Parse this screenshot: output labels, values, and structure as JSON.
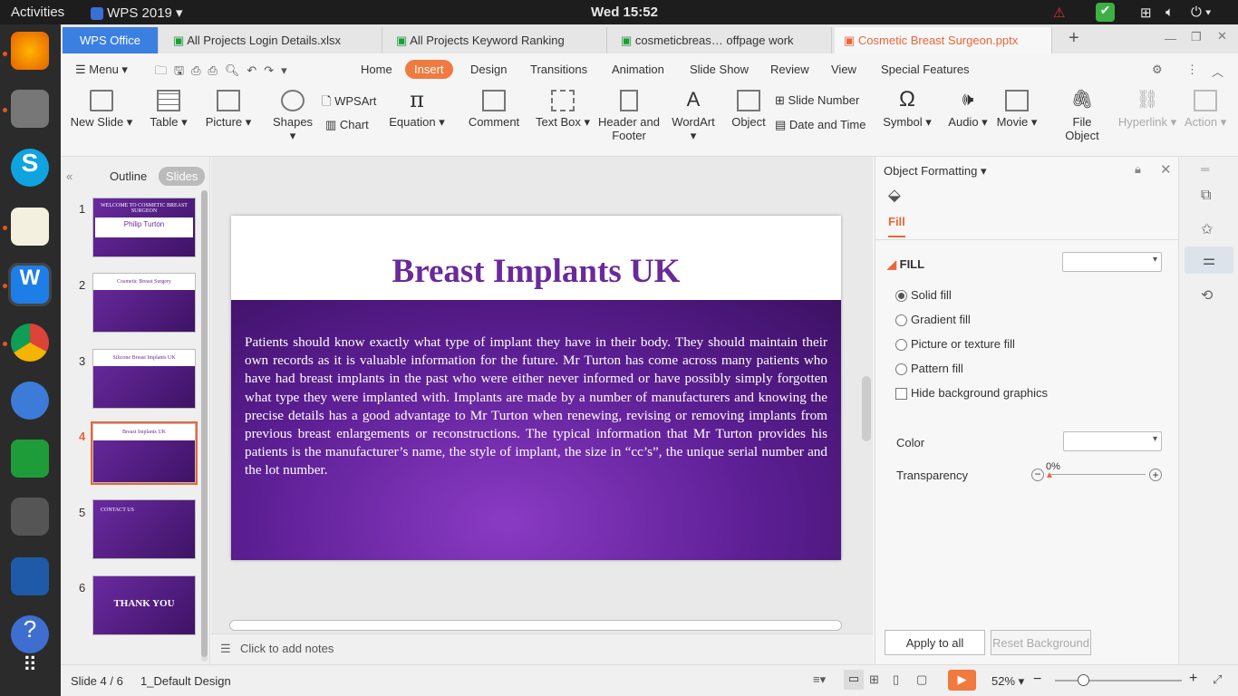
{
  "topbar": {
    "activities": "Activities",
    "app": "WPS 2019",
    "clock": "Wed 15:52"
  },
  "tabs": {
    "wps_office": "WPS Office",
    "t1": "All Projects Login Details.xlsx",
    "t2": "All Projects Keyword Ranking",
    "t3": "cosmeticbreas… offpage work",
    "t4": "Cosmetic Breast Surgeon.pptx"
  },
  "menu": {
    "menu": "Menu",
    "items": [
      "Home",
      "Insert",
      "Design",
      "Transitions",
      "Animation",
      "Slide Show",
      "Review",
      "View",
      "Special Features"
    ]
  },
  "ribbon": {
    "new_slide": "New Slide",
    "table": "Table",
    "picture": "Picture",
    "shapes": "Shapes",
    "wpsart": "WPSArt",
    "chart": "Chart",
    "equation": "Equation",
    "comment": "Comment",
    "text_box": "Text Box",
    "header_footer_1": "Header and",
    "header_footer_2": "Footer",
    "wordart": "WordArt",
    "object": "Object",
    "slide_number": "Slide Number",
    "date_time": "Date and Time",
    "symbol": "Symbol",
    "audio": "Audio",
    "movie": "Movie",
    "file_object": "File Object",
    "hyperlink": "Hyperlink",
    "action": "Action"
  },
  "leftpanel": {
    "outline": "Outline",
    "slides": "Slides",
    "thumbs": [
      {
        "num": "1",
        "title": "WELCOME TO COSMETIC BREAST SURGEON",
        "sub": "Philip Turton"
      },
      {
        "num": "2",
        "title": "Cosmetic Breast Surgery"
      },
      {
        "num": "3",
        "title": "Silicone Breast Implants UK"
      },
      {
        "num": "4",
        "title": "Breast Implants UK"
      },
      {
        "num": "5",
        "title": "CONTACT US"
      },
      {
        "num": "6",
        "title": "THANK YOU"
      }
    ]
  },
  "slide": {
    "title": "Breast Implants UK",
    "body": "Patients should know exactly what type of implant they have in their body. They should maintain their own records as it is valuable information for the future. Mr Turton has come across many patients who have had breast implants in the past who were either never informed or have possibly simply forgotten what type they were implanted with. Implants are made by a number of manufacturers and knowing the precise details has a good advantage to Mr Turton when renewing, revising or removing implants from previous breast enlargements or reconstructions. The typical information that Mr Turton provides his patients is the manufacturer’s name, the style of implant, the size in “cc’s”, the unique serial number and the lot number."
  },
  "notes": {
    "placeholder": "Click to add notes"
  },
  "rightpanel": {
    "title": "Object Formatting",
    "tab": "Fill",
    "section": "FILL",
    "solid": "Solid fill",
    "gradient": "Gradient fill",
    "picture": "Picture or texture fill",
    "pattern": "Pattern fill",
    "hide_bg": "Hide background graphics",
    "color": "Color",
    "transparency": "Transparency",
    "transparency_value": "0%",
    "apply_all": "Apply to all",
    "reset_bg": "Reset Background"
  },
  "status": {
    "slide": "Slide 4 / 6",
    "design": "1_Default Design",
    "zoom": "52%"
  },
  "colors": {
    "accent": "#e95420",
    "slide_purple": "#5b1e92",
    "title_purple": "#6a2a9a",
    "insert_tab": "#f07a3f"
  }
}
